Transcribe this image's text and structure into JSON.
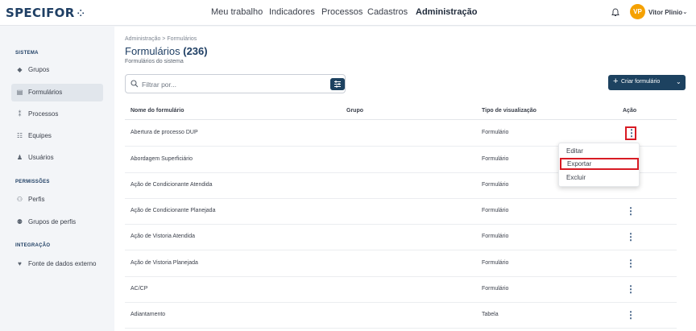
{
  "app": {
    "logo": "SPECIFOR"
  },
  "topnav": [
    {
      "label": "Meu trabalho",
      "active": false
    },
    {
      "label": "Indicadores",
      "active": false
    },
    {
      "label": "Processos",
      "active": false
    },
    {
      "label": "Cadastros",
      "active": false
    },
    {
      "label": "Administração",
      "active": true
    }
  ],
  "user": {
    "initials": "VP",
    "name": "Vitor Plinio"
  },
  "sidebar": {
    "sections": [
      {
        "title": "SISTEMA"
      },
      {
        "title": "PERMISSÕES"
      },
      {
        "title": "INTEGRAÇÃO"
      }
    ],
    "items": [
      {
        "label": "Grupos",
        "icon": "tag-icon"
      },
      {
        "label": "Formulários",
        "icon": "clipboard-icon",
        "active": true
      },
      {
        "label": "Processos",
        "icon": "flow-icon"
      },
      {
        "label": "Equipes",
        "icon": "team-icon"
      },
      {
        "label": "Usuários",
        "icon": "user-icon"
      },
      {
        "label": "Perfis",
        "icon": "profile-icon"
      },
      {
        "label": "Grupos de perfis",
        "icon": "profile-group-icon"
      },
      {
        "label": "Fonte de dados externo",
        "icon": "plug-icon"
      }
    ]
  },
  "page": {
    "breadcrumb": "Administração  >  Formulários",
    "title": "Formulários",
    "count": "(236)",
    "subtitle": "Formulários do sistema",
    "search_placeholder": "Filtrar por...",
    "create_label": "Criar formulário"
  },
  "table": {
    "headers": [
      "Nome do formulário",
      "Grupo",
      "Tipo de visualização",
      "Ação"
    ],
    "rows": [
      {
        "name": "Abertura de processo DUP",
        "group": "",
        "type": "Formulário"
      },
      {
        "name": "Abordagem Superficiário",
        "group": "",
        "type": "Formulário"
      },
      {
        "name": "Ação de Condicionante Atendida",
        "group": "",
        "type": "Formulário"
      },
      {
        "name": "Ação de Condicionante Planejada",
        "group": "",
        "type": "Formulário"
      },
      {
        "name": "Ação de Vistoria Atendida",
        "group": "",
        "type": "Formulário"
      },
      {
        "name": "Ação de Vistoria Planejada",
        "group": "",
        "type": "Formulário"
      },
      {
        "name": "AC/CP",
        "group": "",
        "type": "Formulário"
      },
      {
        "name": "Adiantamento",
        "group": "",
        "type": "Tabela"
      }
    ]
  },
  "context_menu": {
    "items": [
      {
        "label": "Editar"
      },
      {
        "label": "Exportar",
        "highlighted": true
      },
      {
        "label": "Excluir"
      }
    ]
  },
  "colors": {
    "brand": "#1d4260",
    "highlight": "#d81b24",
    "avatar": "#f5a100"
  }
}
